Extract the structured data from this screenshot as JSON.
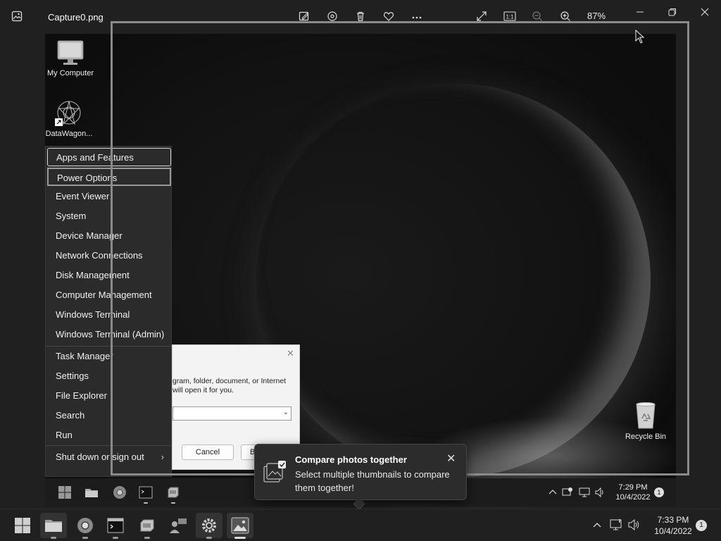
{
  "window": {
    "filename": "Capture0.png",
    "zoom": "87%",
    "toolbar_icons": [
      "edit-image-icon",
      "rotate-icon",
      "delete-icon",
      "favorite-icon",
      "more-icon"
    ],
    "view_icons": [
      "fullscreen-icon",
      "actual-size-icon",
      "zoom-out-icon",
      "zoom-in-icon"
    ]
  },
  "desktop": {
    "icons": [
      {
        "label": "My Computer",
        "icon": "monitor-icon"
      },
      {
        "label": "DataWagon...",
        "icon": "datawagon-icon"
      },
      {
        "label": "Recycle Bin",
        "icon": "recycle-bin-icon"
      }
    ]
  },
  "quick_menu": {
    "items": [
      {
        "label": "Apps and Features"
      },
      {
        "label": "Power Options"
      },
      {
        "label": "Event Viewer"
      },
      {
        "label": "System"
      },
      {
        "label": "Device Manager"
      },
      {
        "label": "Network Connections"
      },
      {
        "label": "Disk Management"
      },
      {
        "label": "Computer Management"
      },
      {
        "label": "Windows Terminal"
      },
      {
        "label": "Windows Terminal (Admin)"
      },
      {
        "label": "Task Manager"
      },
      {
        "label": "Settings"
      },
      {
        "label": "File Explorer"
      },
      {
        "label": "Search"
      },
      {
        "label": "Run"
      },
      {
        "label": "Shut down or sign out"
      }
    ],
    "submenu_glyph": "›"
  },
  "run_dialog": {
    "line1": "gram, folder, document, or Internet",
    "line2": "will open it for you.",
    "cancel": "Cancel",
    "browse": "B"
  },
  "inner_taskbar": {
    "time": "7:29 PM",
    "date": "10/4/2022",
    "badge": "1"
  },
  "tip": {
    "title": "Compare photos together",
    "body": "Select multiple thumbnails to compare them together!",
    "close_glyph": "✕"
  },
  "taskbar": {
    "time": "7:33 PM",
    "date": "10/4/2022",
    "badge": "1",
    "apps": [
      "start-icon",
      "file-explorer-icon",
      "chrome-icon",
      "terminal-icon",
      "storage-icon",
      "people-icon",
      "settings-icon",
      "photos-icon"
    ]
  },
  "colors": {
    "background": "#202020",
    "menu": "#2b2b2b",
    "tip": "#2c2c2c"
  }
}
